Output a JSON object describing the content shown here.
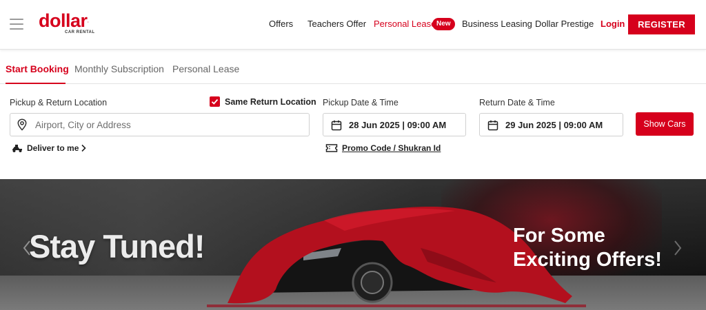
{
  "brand": {
    "name": "dollar",
    "tagline": "CAR RENTAL"
  },
  "nav": {
    "items": [
      "Offers",
      "Teachers Offer",
      "Personal Lease",
      "Business Leasing",
      "Dollar Prestige"
    ],
    "new_badge": "New",
    "login": "Login",
    "register": "REGISTER"
  },
  "tabs": [
    "Start Booking",
    "Monthly Subscription",
    "Personal Lease"
  ],
  "booking": {
    "pickup_return_label": "Pickup & Return Location",
    "location_placeholder": "Airport, City or Address",
    "same_return_label": "Same Return Location",
    "same_return_checked": true,
    "pickup_datetime_label": "Pickup Date & Time",
    "pickup_datetime_value": "28 Jun 2025 |  09:00 AM",
    "return_datetime_label": "Return Date & Time",
    "return_datetime_value": "29 Jun 2025 | 09:00 AM",
    "show_cars": "Show Cars",
    "deliver_label": "Deliver to me",
    "promo_label": "Promo Code / Shukran Id"
  },
  "banner": {
    "headline": "Stay Tuned!",
    "line1": "For Some",
    "line2": "Exciting Offers!"
  },
  "colors": {
    "brand_red": "#d6001c",
    "text_dark": "#222222",
    "border": "#d0d0d0"
  }
}
